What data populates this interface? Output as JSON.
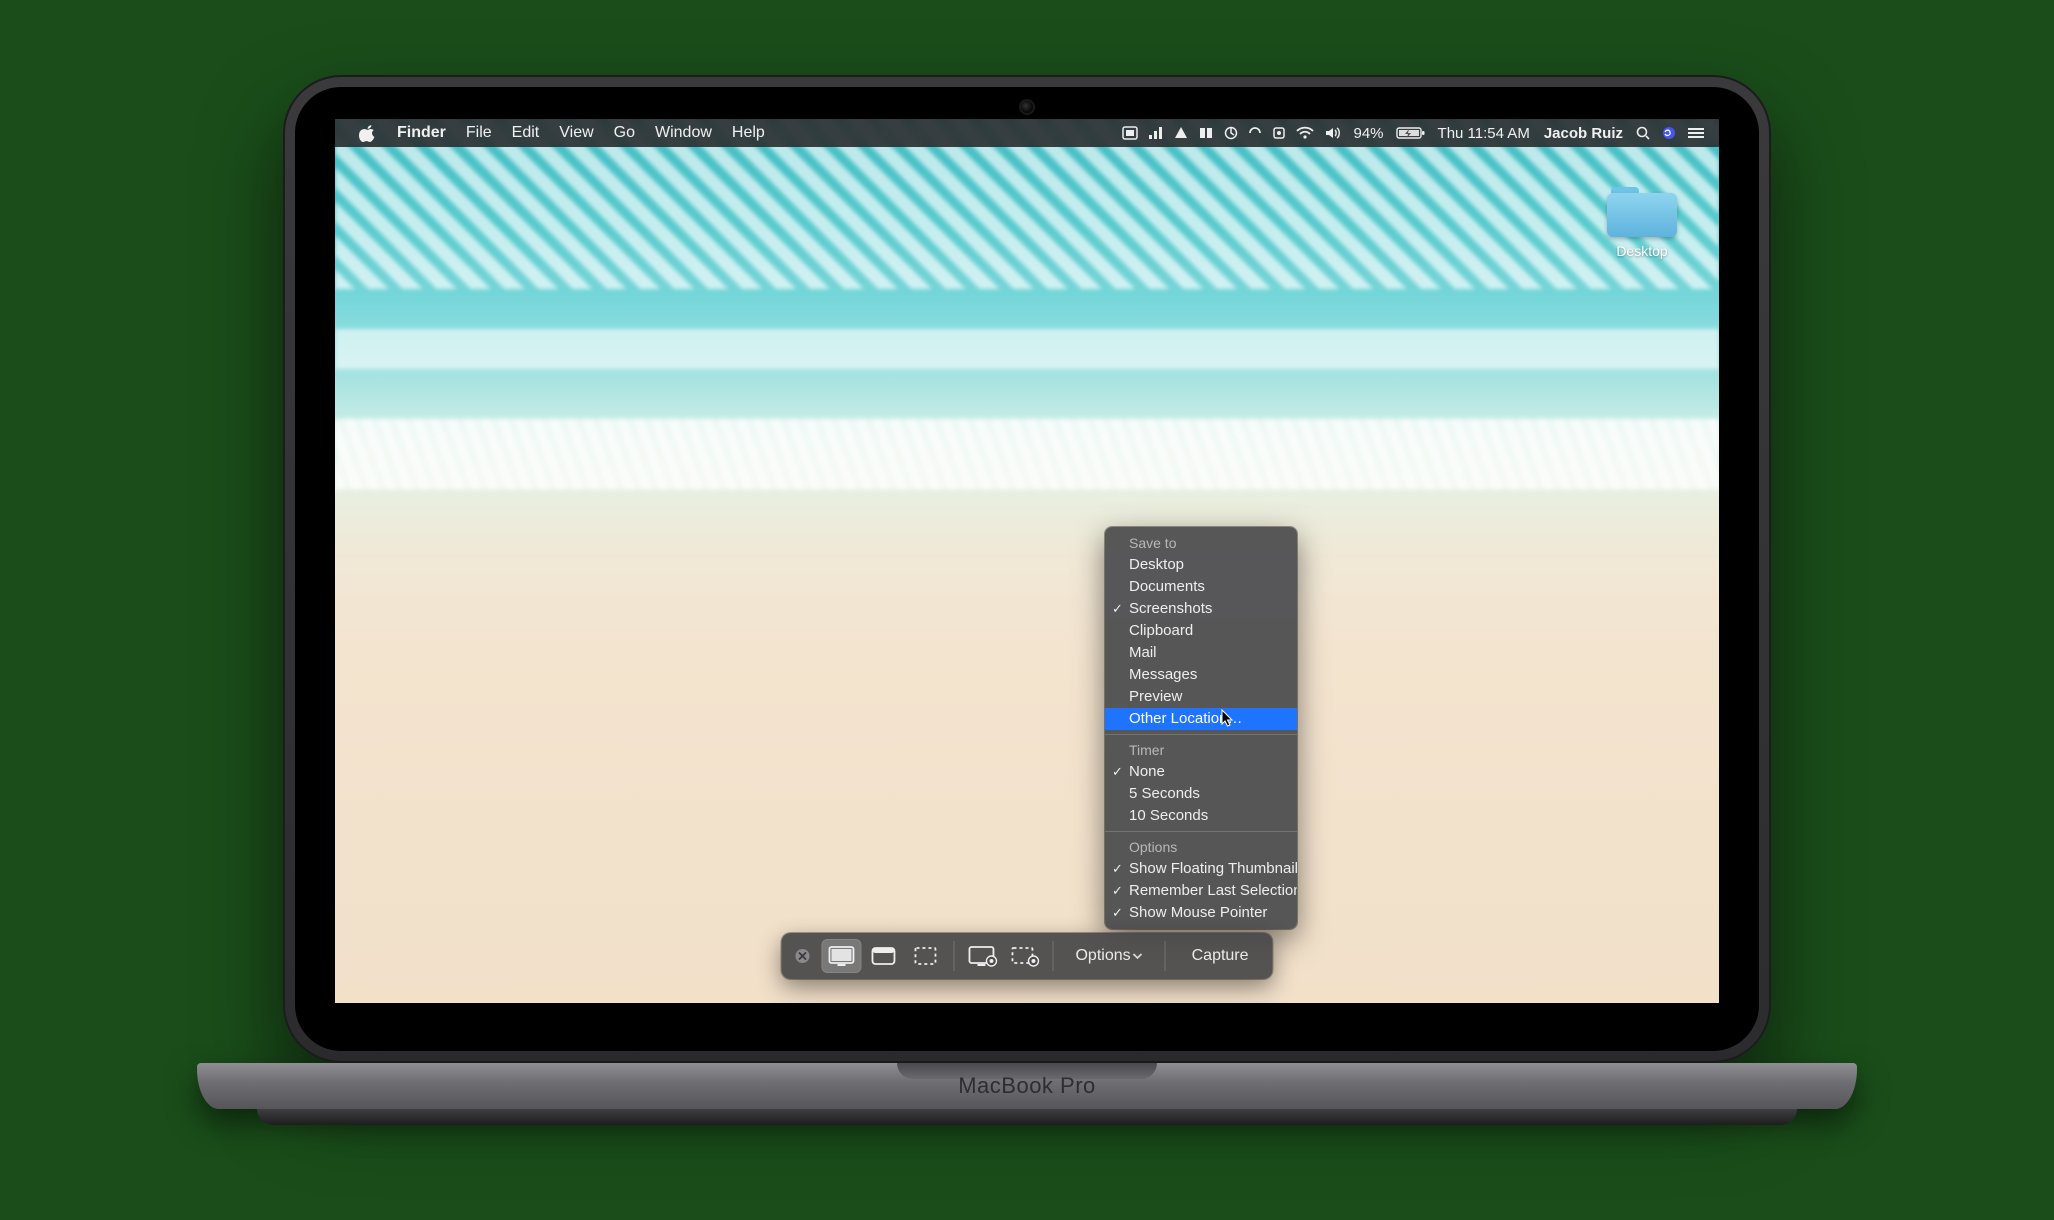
{
  "device_label": "MacBook Pro",
  "menubar": {
    "app": "Finder",
    "menus": [
      "File",
      "Edit",
      "View",
      "Go",
      "Window",
      "Help"
    ],
    "battery_pct": "94%",
    "clock": "Thu 11:54 AM",
    "user": "Jacob Ruiz"
  },
  "desktop": {
    "folder_label": "Desktop"
  },
  "toolbar": {
    "options_label": "Options",
    "capture_label": "Capture"
  },
  "options_menu": {
    "save_to_title": "Save to",
    "save_to": [
      {
        "label": "Desktop",
        "checked": false,
        "highlighted": false
      },
      {
        "label": "Documents",
        "checked": false,
        "highlighted": false
      },
      {
        "label": "Screenshots",
        "checked": true,
        "highlighted": false
      },
      {
        "label": "Clipboard",
        "checked": false,
        "highlighted": false
      },
      {
        "label": "Mail",
        "checked": false,
        "highlighted": false
      },
      {
        "label": "Messages",
        "checked": false,
        "highlighted": false
      },
      {
        "label": "Preview",
        "checked": false,
        "highlighted": false
      },
      {
        "label": "Other Location…",
        "checked": false,
        "highlighted": true
      }
    ],
    "timer_title": "Timer",
    "timer": [
      {
        "label": "None",
        "checked": true
      },
      {
        "label": "5 Seconds",
        "checked": false
      },
      {
        "label": "10 Seconds",
        "checked": false
      }
    ],
    "options_title": "Options",
    "options": [
      {
        "label": "Show Floating Thumbnail",
        "checked": true
      },
      {
        "label": "Remember Last Selection",
        "checked": true
      },
      {
        "label": "Show Mouse Pointer",
        "checked": true
      }
    ]
  }
}
